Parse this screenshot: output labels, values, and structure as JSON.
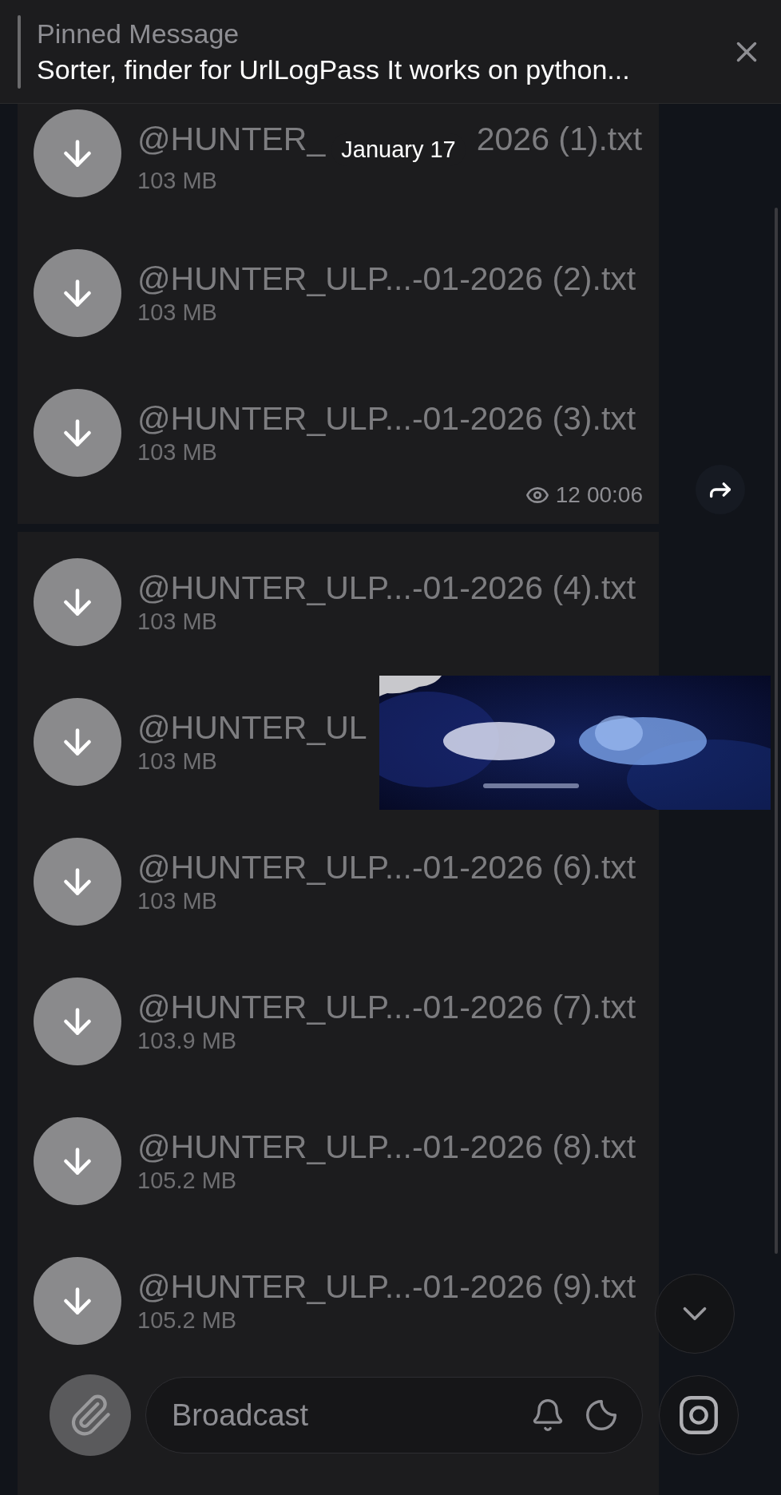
{
  "pinned": {
    "title": "Pinned Message",
    "text": "Sorter, finder for UrlLogPass It works on python..."
  },
  "date": "January 17",
  "messages": [
    {
      "files": [
        {
          "kind": "covered-by-date",
          "name": "@HUNTER_",
          "name_end": "2026 (1).txt",
          "size": "103 MB"
        },
        {
          "kind": "plain",
          "name": "@HUNTER_ULP...-01-2026 (2).txt",
          "size": "103 MB"
        },
        {
          "kind": "plain",
          "name": "@HUNTER_ULP...-01-2026 (3).txt",
          "size": "103 MB"
        }
      ],
      "views": "12",
      "time": "00:06"
    },
    {
      "files": [
        {
          "kind": "plain",
          "name": "@HUNTER_ULP...-01-2026 (4).txt",
          "size": "103 MB"
        },
        {
          "kind": "covered-by-banner",
          "name": "@HUNTER_UL",
          "size": "103 MB"
        },
        {
          "kind": "plain",
          "name": "@HUNTER_ULP...-01-2026 (6).txt",
          "size": "103 MB"
        },
        {
          "kind": "plain",
          "name": "@HUNTER_ULP...-01-2026 (7).txt",
          "size": "103.9 MB"
        },
        {
          "kind": "plain",
          "name": "@HUNTER_ULP...-01-2026 (8).txt",
          "size": "105.2 MB"
        },
        {
          "kind": "plain",
          "name": "@HUNTER_ULP...-01-2026 (9).txt",
          "size": "105.2 MB"
        }
      ]
    }
  ],
  "composer": {
    "placeholder": "Broadcast"
  }
}
